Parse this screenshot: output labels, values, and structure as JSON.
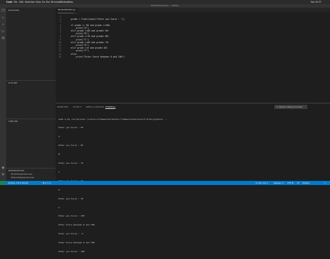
{
  "mac_menu": {
    "items": [
      "Code",
      "File",
      "Edit",
      "Selection",
      "View",
      "Go",
      "Run",
      "Terminal",
      "Window",
      "Help"
    ],
    "clock": "Sat 10:27"
  },
  "window": {
    "title": "StudentGrade.py — Python"
  },
  "sidebar": {
    "explorer_label": "EXPLORER",
    "outline_label": "OUTLINE",
    "timeline_label": "TIMELINE",
    "dependencies_label": "DEPENDENCIES",
    "dep_items": [
      "BuiltinDependencies",
      "ExternalDependencies"
    ]
  },
  "editor": {
    "tab_label": "StudentGrade.py",
    "breadcrumb": "StudentGrade.py > ...",
    "lines": [
      "",
      "grade = float(input(\"Enter you Score : \"))",
      "",
      "if grade >= 90 and grade <=100:",
      "    print(\"A\")",
      "elif grade >=80 and grade< 90:",
      "    print(\"B\")",
      "elif grade >=70 and grade< 80:",
      "    print(\"C\")",
      "elif grade >=60 and grade< 70:",
      "    print(\"D\")",
      "elif grade >=0 and grade< 60:",
      "    print(\"F\")",
      "else:",
      "    print(\"Enter Score between 0 and 100\")"
    ]
  },
  "panel": {
    "tabs": [
      "PROBLEMS",
      "OUTPUT",
      "DEBUG CONSOLE",
      "TERMINAL"
    ],
    "terminal_select": "1: Python Debug Console",
    "terminal_lines": [
      "bash-3.2$ /usr/bin/env /Library/Frameworks/Python.framework/Versions/3.8/bin/python3 ...",
      "Enter you Score : 95",
      "A",
      "Enter you Score : 85",
      "B",
      "Enter you Score : 75",
      "C",
      "Enter you Score : 65",
      "D",
      "Enter you Score : 45",
      "F",
      "Enter you Score : 105",
      "Enter Score between 0 and 100",
      "Enter you Score : -5",
      "Enter Score between 0 and 100",
      "Enter you Score : 100"
    ]
  },
  "status": {
    "left": "Python 3.8.5 64-bit",
    "errors": "⊗ 0 ⚠ 0",
    "position": "Ln 16, Col 1",
    "spaces": "Spaces: 4",
    "encoding": "UTF-8",
    "eol": "LF",
    "language": "Python"
  }
}
